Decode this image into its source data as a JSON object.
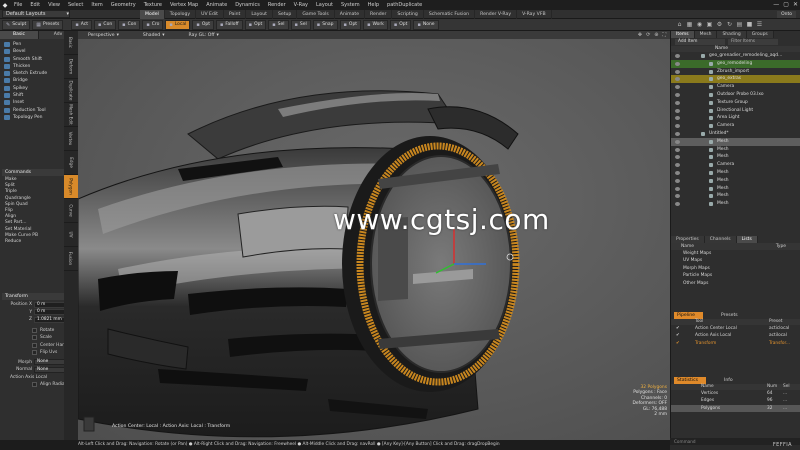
{
  "menubar": {
    "app_icon": "modo-logo-icon",
    "items": [
      "File",
      "Edit",
      "View",
      "Select",
      "Item",
      "Geometry",
      "Texture",
      "Vertex Map",
      "Animate",
      "Dynamics",
      "Render",
      "V-Ray",
      "Layout",
      "System",
      "Help",
      "pathDuplicate"
    ],
    "win_controls": [
      "—",
      "▢",
      "✕"
    ]
  },
  "tabbar": {
    "layout_select": "Default Layouts",
    "tabs": [
      "Model",
      "Topology",
      "UV Edit",
      "Paint",
      "Layout",
      "Setup",
      "Game Tools",
      "Animate",
      "Render",
      "Scripting",
      "Schematic Fusion",
      "Render V-Ray",
      "V-Ray VFB"
    ],
    "active_tab": "Model",
    "right_button": "Onto"
  },
  "toolbar": {
    "left_buttons": [
      "Sculpt",
      "Presets"
    ],
    "buttons": [
      "Act",
      "Con",
      "Con",
      "Cro",
      "Local",
      "Opt",
      "Falloff",
      "Opt",
      "Sel",
      "Sel",
      "Snap",
      "Opt",
      "Work",
      "Opt",
      "None"
    ]
  },
  "left_panel": {
    "tabs": [
      "Basic",
      "Adv"
    ],
    "tools": [
      "Pen",
      "Bevel",
      "Smooth Shift",
      "Thicken",
      "Sketch Extrude",
      "Bridge",
      "Spikey",
      "Shift",
      "Inset",
      "Reduction Tool",
      "Topology Pen"
    ],
    "side_tabs": [
      "Basic",
      "Deform",
      "Duplicate",
      "Mesh Edit",
      "Vertex",
      "Edge",
      "Polygon",
      "Curve",
      "UV",
      "Fusion"
    ],
    "active_side_tab": "Polygon",
    "commands_title": "Commands",
    "commands": [
      "Make",
      "Split",
      "Triple",
      "Quadrangle",
      "Spin Quad",
      "Flip",
      "Align",
      "Set Part...",
      "Set Material",
      "Make Curve PB",
      "Reduce"
    ],
    "transform_title": "Transform",
    "position": {
      "label": "Position X",
      "x": "0 m",
      "y_label": "Y",
      "y": "0 m",
      "z_label": "Z",
      "z": "1.0821 mm"
    },
    "checks": [
      "Rotate",
      "Scale",
      "Center Handle",
      "Flip Uvs"
    ],
    "morph": {
      "label": "Morph",
      "value": "None"
    },
    "normal": {
      "label": "Normal",
      "value": "None"
    },
    "action_axis": "Action Axis Local",
    "align_radial": "Align Radial"
  },
  "viewport": {
    "header_options": [
      "Perspective",
      "Shaded",
      "Ray GL: Off"
    ],
    "watermark": "www.cgtsj.com",
    "status_left": "Action Center: Local : Action Axis: Local : Transform",
    "status_right": [
      "32 Polygons",
      "Polygons : Face",
      "Channels: 0",
      "Deformers: OFF",
      "GL: 76,488",
      "2 mm"
    ]
  },
  "right_panel": {
    "top_tabs": [
      "Items",
      "Mesh",
      "Shading",
      "Groups"
    ],
    "active_top_tab": "Items",
    "add_item": "Add Item",
    "filter_placeholder": "Filter Items",
    "name_header": "Name",
    "tree": [
      {
        "label": "geo_grenadier_remodeling_aqd...",
        "indent": 38,
        "style": ""
      },
      {
        "label": "geo_remodeling",
        "indent": 46,
        "style": "green"
      },
      {
        "label": "Zbrush_import",
        "indent": 46,
        "style": ""
      },
      {
        "label": "geo_extras",
        "indent": 46,
        "style": "yellow"
      },
      {
        "label": "Camera",
        "indent": 46,
        "style": ""
      },
      {
        "label": "Outdoor Probe 03.lxo",
        "indent": 46,
        "style": ""
      },
      {
        "label": "Texture Group",
        "indent": 46,
        "style": ""
      },
      {
        "label": "Directional Light",
        "indent": 46,
        "style": ""
      },
      {
        "label": "Area Light",
        "indent": 46,
        "style": ""
      },
      {
        "label": "Camera",
        "indent": 46,
        "style": ""
      },
      {
        "label": "Untitled*",
        "indent": 38,
        "style": ""
      },
      {
        "label": "Mesh",
        "indent": 46,
        "style": "sel"
      },
      {
        "label": "Mesh",
        "indent": 46,
        "style": ""
      },
      {
        "label": "Mesh",
        "indent": 46,
        "style": ""
      },
      {
        "label": "Camera",
        "indent": 46,
        "style": ""
      },
      {
        "label": "Mesh",
        "indent": 46,
        "style": ""
      },
      {
        "label": "Mesh",
        "indent": 46,
        "style": ""
      },
      {
        "label": "Mesh",
        "indent": 46,
        "style": ""
      },
      {
        "label": "Mesh",
        "indent": 46,
        "style": ""
      },
      {
        "label": "Mesh",
        "indent": 46,
        "style": ""
      }
    ],
    "props_tabs": [
      "Properties",
      "Channels",
      "Lists"
    ],
    "active_props_tab": "Lists",
    "vmap_headers": [
      "Name",
      "Type"
    ],
    "vmaps": [
      "Weight Maps",
      "UV Maps",
      "Morph Maps",
      "Particle Maps",
      "Other Maps"
    ],
    "pipeline_tabs": [
      "Pipeline",
      "Presets"
    ],
    "pipeline_headers": [
      "Tool",
      "Preset"
    ],
    "pipeline": [
      {
        "tool": "Action Center Local",
        "preset": "acticlocal",
        "orange": false
      },
      {
        "tool": "Action Axis Local",
        "preset": "actilocal",
        "orange": false
      },
      {
        "tool": "Transform",
        "preset": "Transfor...",
        "orange": true
      }
    ],
    "stats_tabs": [
      "Statistics",
      "Info"
    ],
    "stats_headers": [
      "Name",
      "Num",
      "Sel"
    ],
    "stats": [
      {
        "name": "Vertices",
        "num": "64",
        "sel": "...",
        "selected": false
      },
      {
        "name": "Edges",
        "num": "96",
        "sel": "...",
        "selected": false
      },
      {
        "name": "Polygons",
        "num": "32",
        "sel": "...",
        "selected": true
      }
    ],
    "command_placeholder": "Command"
  },
  "status_bar": {
    "text": "Alt-Left Click and Drag: Navigation: Rotate (or Pan) ● Alt-Right Click and Drag: Navigation: Freewheel ● Alt-Middle Click and Drag: navRoll ● [Any Key]-[Any Button] Click and Drag: dragDropBegin",
    "brand": "FEFFIA"
  }
}
